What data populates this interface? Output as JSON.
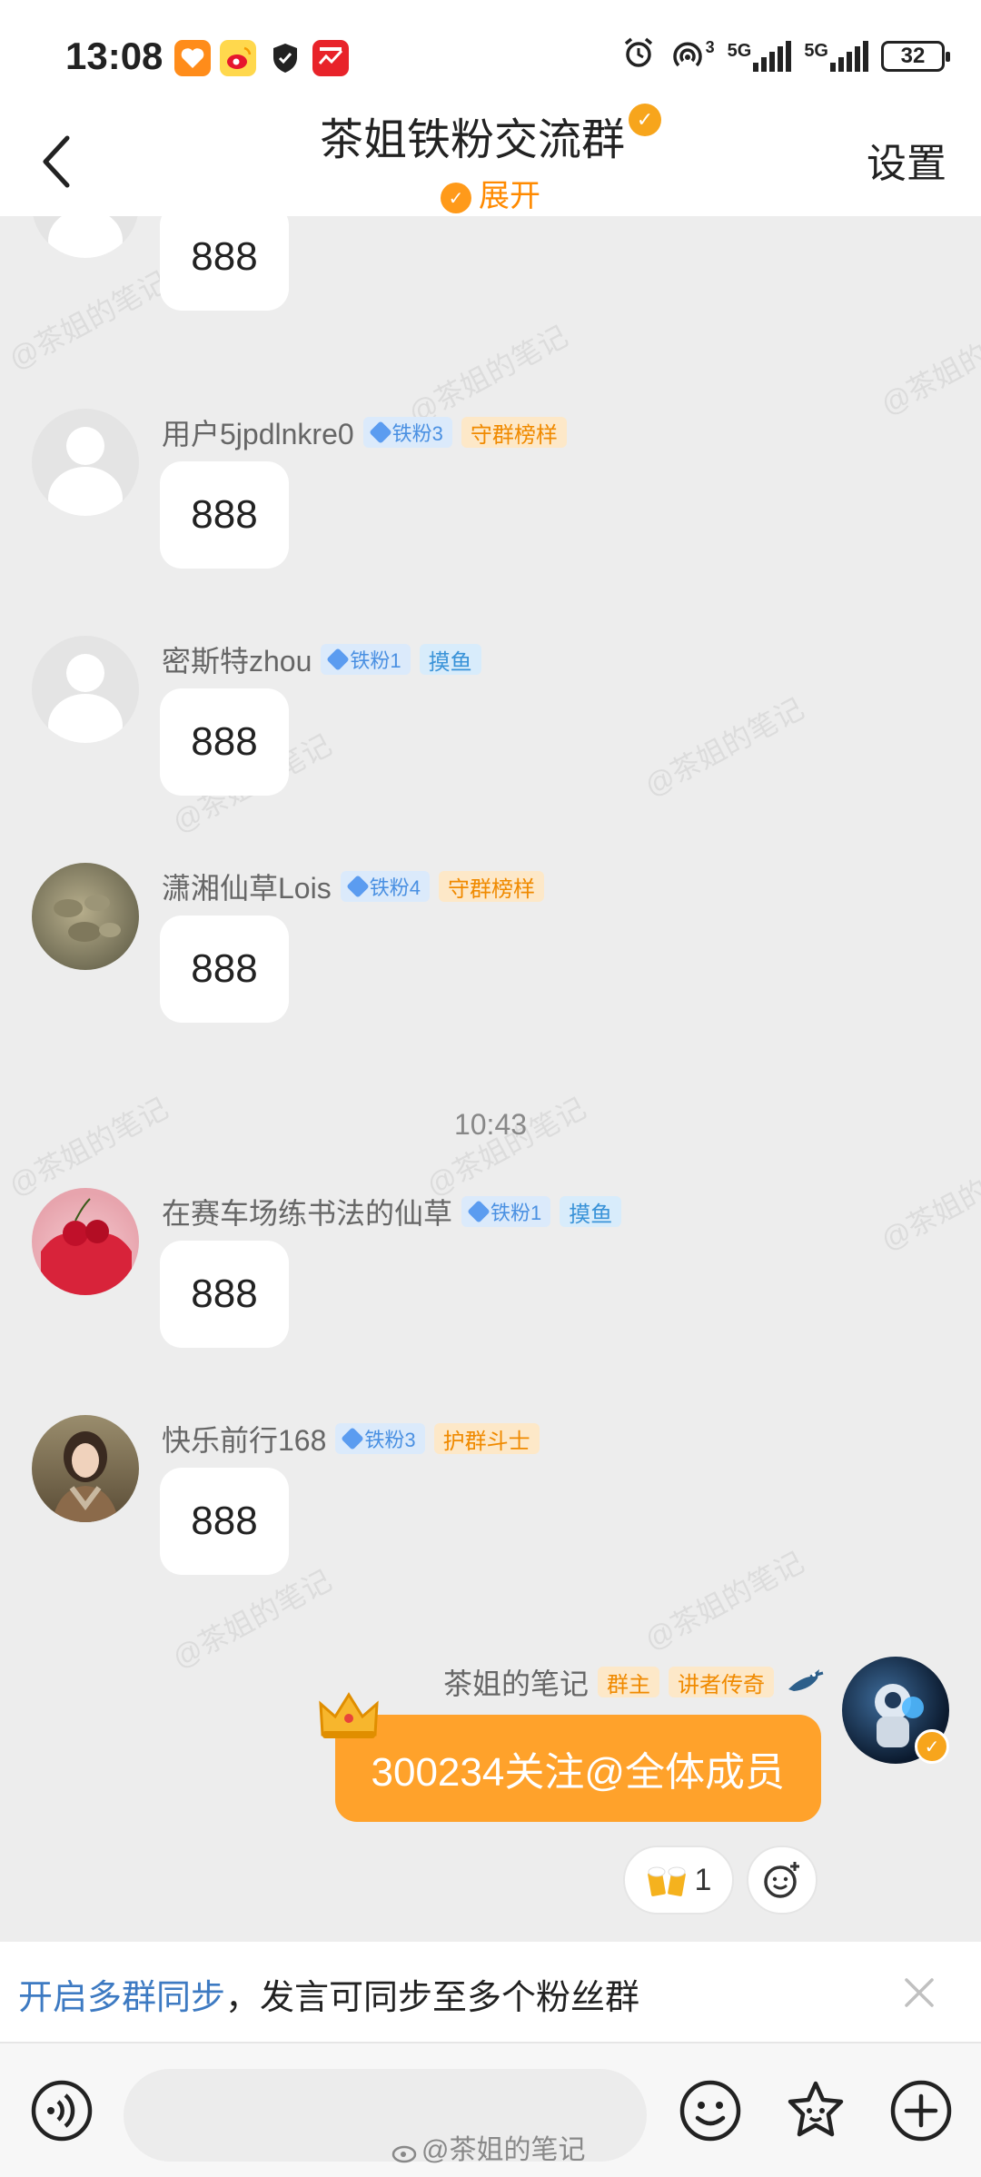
{
  "status_bar": {
    "time": "13:08",
    "net1": "5G",
    "net2": "5G",
    "hotspot_count": "3",
    "battery": "32"
  },
  "header": {
    "title": "茶姐铁粉交流群",
    "expand_label": "展开",
    "settings_label": "设置"
  },
  "messages": [
    {
      "name": "",
      "fan_level": "",
      "tag": "",
      "text": "888"
    },
    {
      "name": "用户5jpdlnkre0",
      "fan_level": "铁粉3",
      "tag": "守群榜样",
      "text": "888"
    },
    {
      "name": "密斯特zhou",
      "fan_level": "铁粉1",
      "tag": "摸鱼",
      "text": "888"
    },
    {
      "name": "潇湘仙草Lois",
      "fan_level": "铁粉4",
      "tag": "守群榜样",
      "text": "888"
    },
    {
      "name": "在赛车场练书法的仙草",
      "fan_level": "铁粉1",
      "tag": "摸鱼",
      "text": "888"
    },
    {
      "name": "快乐前行168",
      "fan_level": "铁粉3",
      "tag": "护群斗士",
      "text": "888"
    }
  ],
  "timestamp": "10:43",
  "owner_message": {
    "name": "茶姐的笔记",
    "role_tag": "群主",
    "title_tag": "讲者传奇",
    "text": "300234关注@全体成员"
  },
  "reactions": {
    "beer_count": "1"
  },
  "sync_banner": {
    "link_text": "开启多群同步",
    "rest_text": "，发言可同步至多个粉丝群"
  },
  "watermark": {
    "text": "@茶姐的笔记",
    "bottom": "@茶姐的笔记"
  },
  "colors": {
    "accent": "#ffa22b",
    "link": "#3d7ac2",
    "fan_badge": "#4a90e2"
  }
}
